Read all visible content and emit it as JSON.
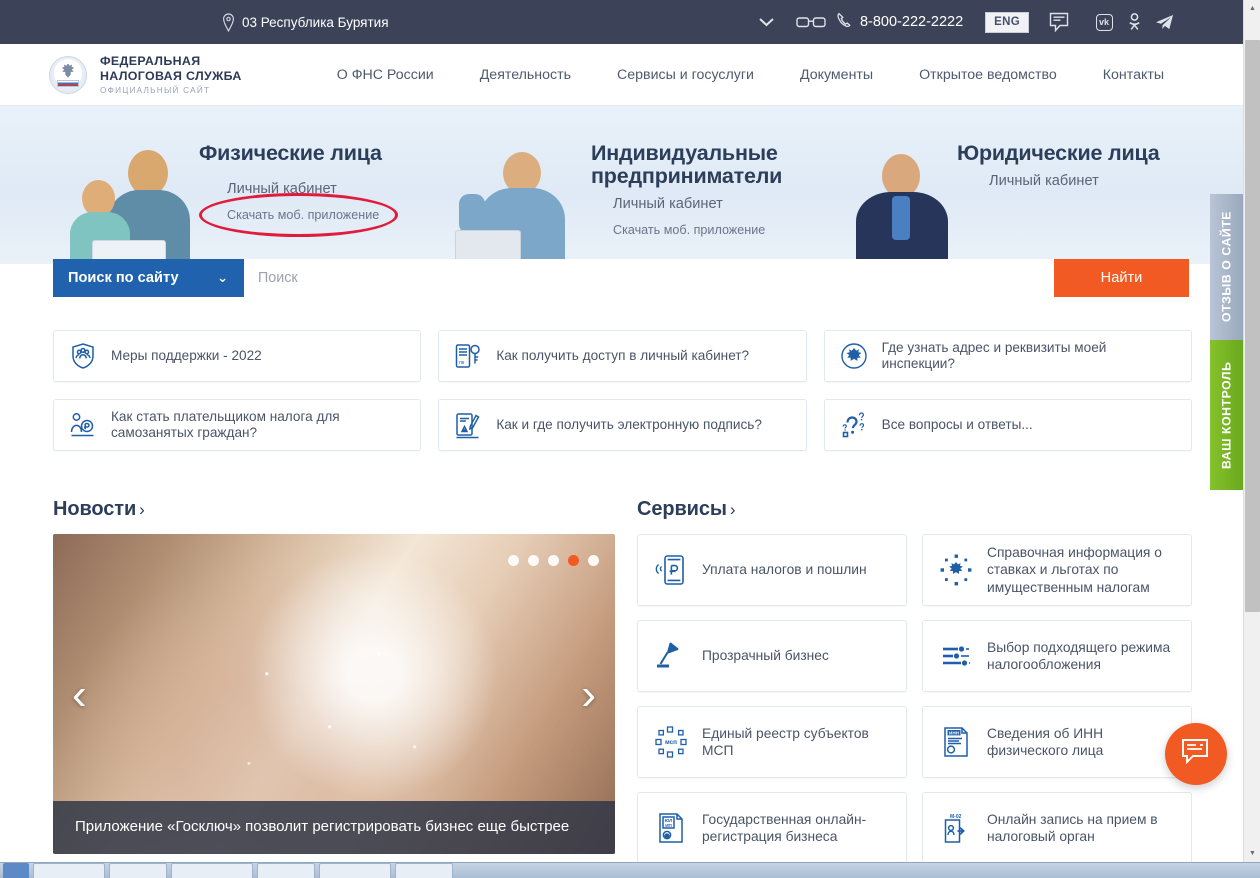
{
  "topbar": {
    "region": "03 Республика Бурятия",
    "phone": "8-800-222-2222",
    "lang_button": "ENG",
    "icons": {
      "pin": "location-pin-icon",
      "chevron": "chevron-down-icon",
      "glasses": "glasses-icon",
      "phone": "phone-icon",
      "message": "message-icon",
      "vk": "vk-icon",
      "ok": "odnoklassniki-icon",
      "telegram": "telegram-icon"
    }
  },
  "header": {
    "logo_line1": "ФЕДЕРАЛЬНАЯ",
    "logo_line2": "НАЛОГОВАЯ СЛУЖБА",
    "logo_sub": "ОФИЦИАЛЬНЫЙ САЙТ",
    "nav": [
      {
        "label": "О ФНС России"
      },
      {
        "label": "Деятельность"
      },
      {
        "label": "Сервисы и госуслуги"
      },
      {
        "label": "Документы"
      },
      {
        "label": "Открытое ведомство"
      },
      {
        "label": "Контакты"
      }
    ]
  },
  "hero": {
    "columns": [
      {
        "title": "Физические лица",
        "link": "Личный кабинет",
        "sub": "Скачать моб. приложение"
      },
      {
        "title": "Индивидуальные предприниматели",
        "link": "Личный кабинет",
        "sub": "Скачать моб. приложение"
      },
      {
        "title": "Юридические лица",
        "link": "Личный кабинет",
        "sub": ""
      }
    ],
    "annotation": {
      "shape": "ellipse",
      "color": "#e01b3c",
      "target": "Личный кабинет"
    }
  },
  "search": {
    "scope_label": "Поиск по сайту",
    "placeholder": "Поиск",
    "value": "",
    "button": "Найти",
    "button_color": "#f15a22",
    "scope_color": "#2062ad"
  },
  "quicklinks": [
    {
      "label": "Меры поддержки - 2022",
      "icon": "shield-people-icon"
    },
    {
      "label": "Как получить доступ в личный кабинет?",
      "icon": "key-card-icon"
    },
    {
      "label": "Где узнать адрес и реквизиты моей инспекции?",
      "icon": "emblem-circle-icon"
    },
    {
      "label": "Как стать плательщиком налога для самозанятых граждан?",
      "icon": "person-ruble-icon"
    },
    {
      "label": "Как и где получить электронную подпись?",
      "icon": "signature-doc-icon"
    },
    {
      "label": "Все вопросы и ответы...",
      "icon": "question-marks-icon"
    }
  ],
  "news": {
    "title": "Новости",
    "arrow": "›",
    "caption": "Приложение «Госключ» позволит регистрировать бизнес еще быстрее",
    "slides_total": 5,
    "active_slide": 4,
    "prev_arrow": "‹",
    "next_arrow": "›"
  },
  "services": {
    "title": "Сервисы",
    "arrow": "›",
    "items": [
      {
        "label": "Уплата налогов и пошлин",
        "icon": "phone-ruble-icon"
      },
      {
        "label": "Справочная информация о ставках и льготах по имущественным налогам",
        "icon": "emblem-network-icon"
      },
      {
        "label": "Прозрачный бизнес",
        "icon": "desk-lamp-icon"
      },
      {
        "label": "Выбор подходящего режима налогообложения",
        "icon": "sliders-icon"
      },
      {
        "label": "Единый реестр субъектов МСП",
        "icon": "msp-network-icon"
      },
      {
        "label": "Сведения об ИНН физического лица",
        "icon": "inn-document-icon"
      },
      {
        "label": "Государственная онлайн-регистрация бизнеса",
        "icon": "ul-ip-document-icon"
      },
      {
        "label": "Онлайн запись на прием в налоговый орган",
        "icon": "appointment-door-icon"
      }
    ]
  },
  "sidetabs": [
    {
      "label": "ОТЗЫВ О САЙТЕ",
      "color": "#a7b4c7"
    },
    {
      "label": "ВАШ КОНТРОЛЬ",
      "color": "#7ab824"
    }
  ],
  "fab": {
    "icon": "chat-bubble-icon",
    "color": "#f15a22"
  },
  "scrollbar": {
    "up": "▲",
    "down": "▼"
  }
}
